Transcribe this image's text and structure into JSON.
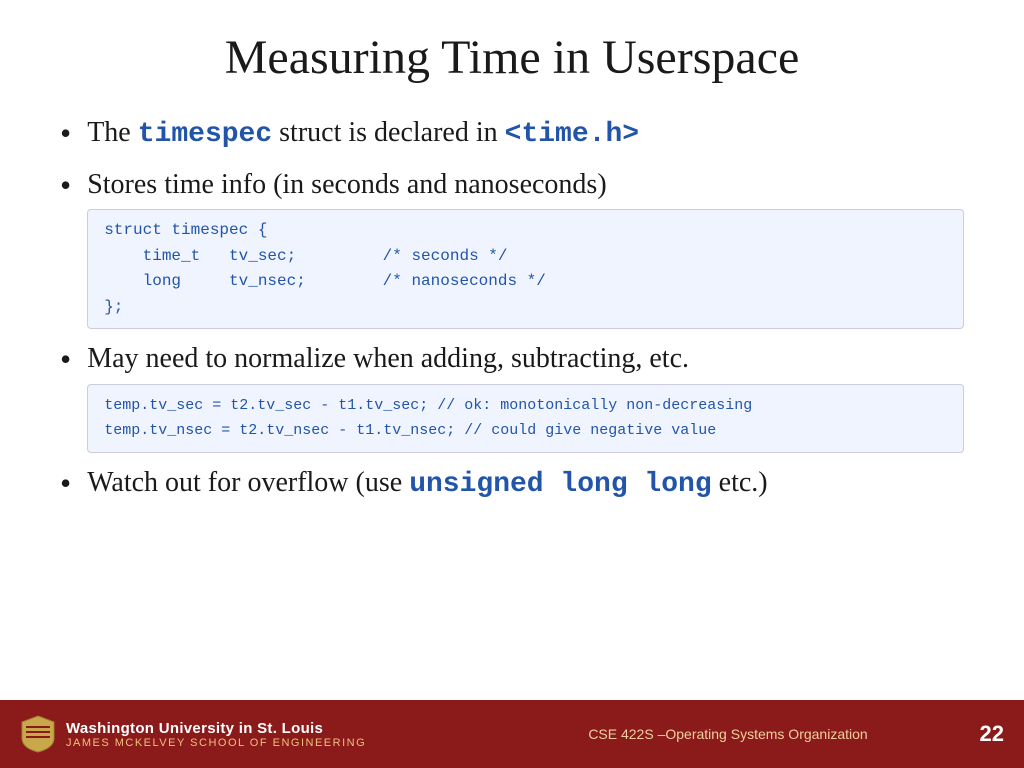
{
  "slide": {
    "title": "Measuring Time in Userspace",
    "bullets": [
      {
        "id": "bullet1",
        "text_before": "The ",
        "code1": "timespec",
        "text_middle": " struct is declared in ",
        "code2": "<time.h>",
        "text_after": ""
      },
      {
        "id": "bullet2",
        "text": "Stores time info (in seconds and nanoseconds)"
      },
      {
        "id": "bullet3",
        "text": "May need to normalize when adding, subtracting, etc."
      },
      {
        "id": "bullet4",
        "text_before": "Watch out for overflow (use ",
        "code1": "unsigned long long",
        "text_after": " etc.)"
      }
    ],
    "code_block1": {
      "line1": "struct timespec {",
      "line2": "    time_t   tv_sec;         /* seconds */",
      "line3": "    long     tv_nsec;        /* nanoseconds */",
      "line4": "};"
    },
    "code_block2": {
      "line1": "temp.tv_sec = t2.tv_sec - t1.tv_sec; // ok: monotonically non-decreasing",
      "line2": "temp.tv_nsec = t2.tv_nsec - t1.tv_nsec; // could give negative value"
    }
  },
  "footer": {
    "university": "Washington University in St. Louis",
    "school": "James McKelvey School of Engineering",
    "course": "CSE 422S –Operating Systems Organization",
    "page": "22"
  }
}
